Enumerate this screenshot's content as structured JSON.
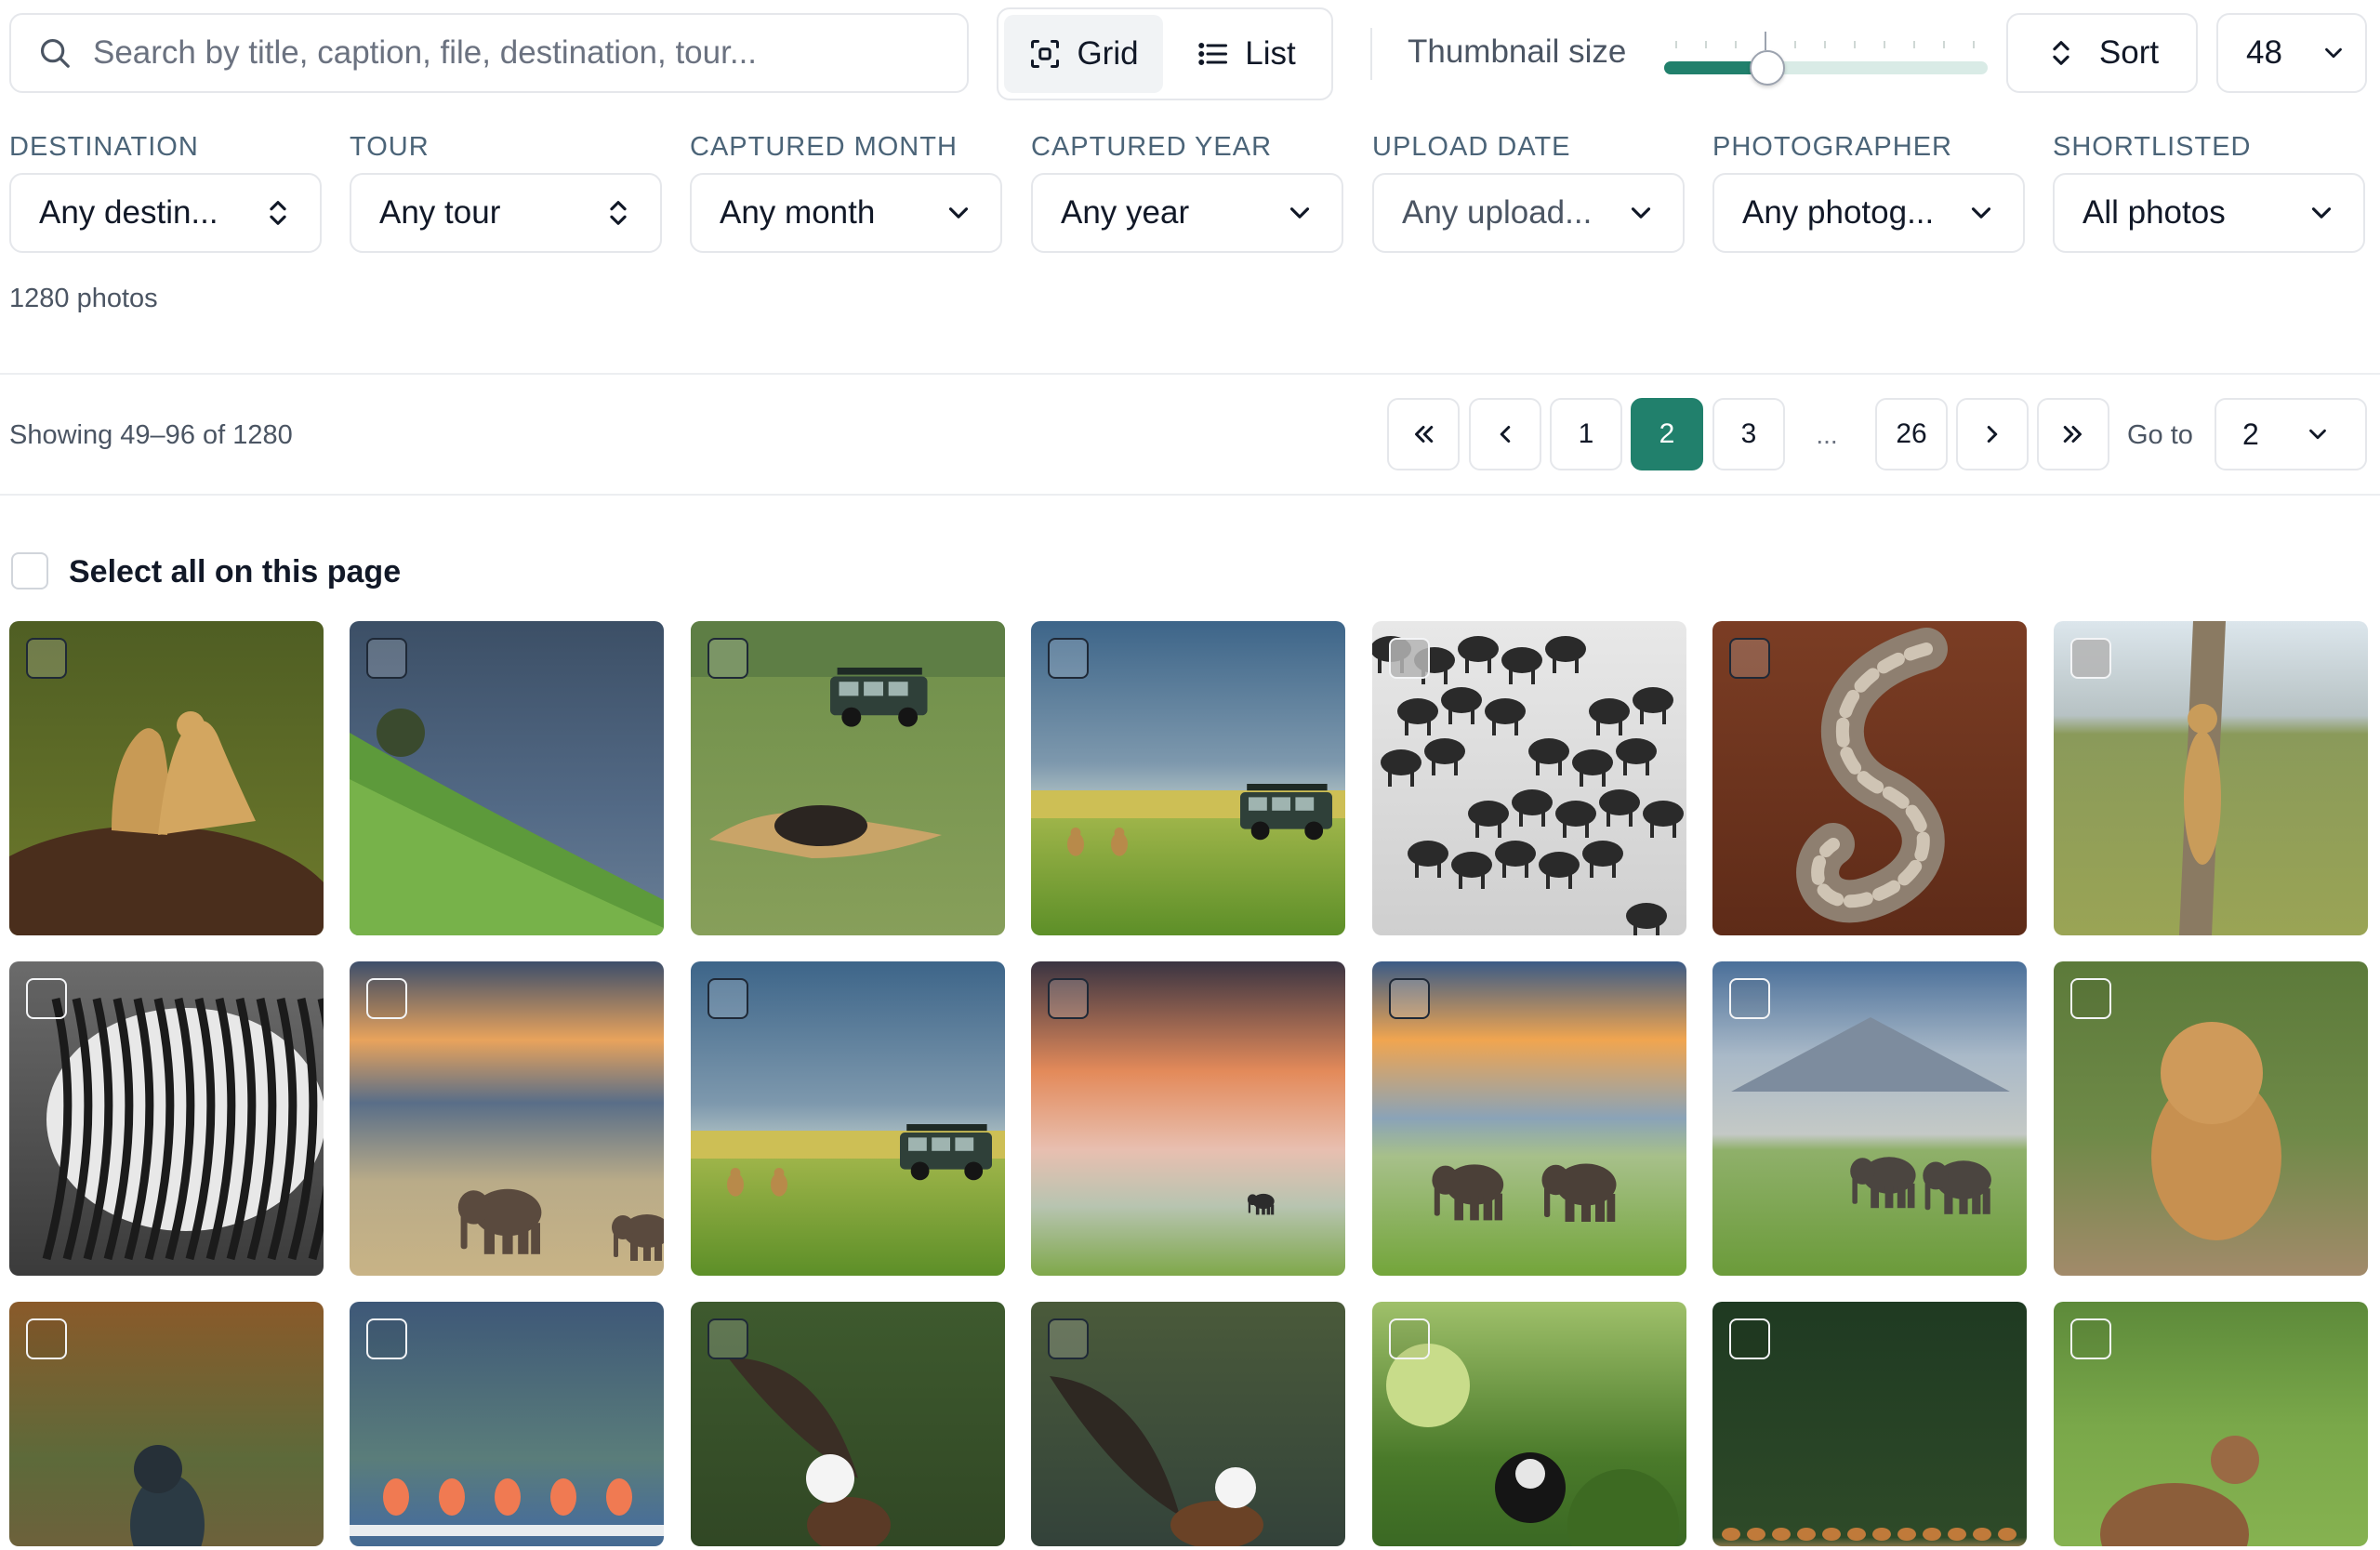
{
  "search": {
    "placeholder": "Search by title, caption, file, destination, tour..."
  },
  "view_toggle": {
    "grid_label": "Grid",
    "list_label": "List",
    "active": "grid"
  },
  "thumbnail": {
    "label": "Thumbnail size",
    "level_percent": 32
  },
  "sort": {
    "label": "Sort",
    "icon": "sort-updown-icon"
  },
  "per_page": {
    "value": "48"
  },
  "filters": [
    {
      "key": "destination",
      "label": "DESTINATION",
      "value": "Any destin...",
      "icon": "updown-icon"
    },
    {
      "key": "tour",
      "label": "TOUR",
      "value": "Any tour",
      "icon": "updown-icon"
    },
    {
      "key": "captured-month",
      "label": "CAPTURED MONTH",
      "value": "Any month",
      "icon": "chevron-down-icon"
    },
    {
      "key": "captured-year",
      "label": "CAPTURED YEAR",
      "value": "Any year",
      "icon": "chevron-down-icon"
    },
    {
      "key": "upload-date",
      "label": "UPLOAD DATE",
      "value": "Any upload...",
      "icon": "chevron-down-icon"
    },
    {
      "key": "photographer",
      "label": "PHOTOGRAPHER",
      "value": "Any photog...",
      "icon": "chevron-down-icon"
    },
    {
      "key": "shortlisted",
      "label": "SHORTLISTED",
      "value": "All photos",
      "icon": "chevron-down-icon"
    }
  ],
  "photo_count": "1280 photos",
  "pagination": {
    "showing": "Showing 49–96 of 1280",
    "pages": [
      "1",
      "2",
      "3",
      "26"
    ],
    "ellipsis": "...",
    "current": "2",
    "goto_label": "Go to",
    "goto_value": "2"
  },
  "select_all_label": "Select all on this page",
  "colors": {
    "accent": "#21806c",
    "border": "#e5e7eb",
    "muted_text": "#4b5563"
  },
  "photos": [
    {
      "subject": "cheetahs-on-termite-mound"
    },
    {
      "subject": "stormy-sky-over-green-hill"
    },
    {
      "subject": "safari-vehicle-lions-on-kill"
    },
    {
      "subject": "safari-vehicle-lions-in-grass"
    },
    {
      "subject": "wildebeest-herd-black-and-white"
    },
    {
      "subject": "puff-adder-snake-on-red-soil"
    },
    {
      "subject": "leopard-climbing-tree"
    },
    {
      "subject": "zebras-black-and-white"
    },
    {
      "subject": "elephant-under-sunset-sky"
    },
    {
      "subject": "safari-vehicle-lions-in-grass"
    },
    {
      "subject": "lone-elephant-under-storm-light"
    },
    {
      "subject": "two-elephants-golden-sky"
    },
    {
      "subject": "elephants-before-kilimanjaro"
    },
    {
      "subject": "lion-cub-walking"
    },
    {
      "subject": "kingfisher-on-branch"
    },
    {
      "subject": "flamingos-on-lake"
    },
    {
      "subject": "fish-eagle-in-flight"
    },
    {
      "subject": "fish-eagle-over-water"
    },
    {
      "subject": "colobus-monkey-in-foliage"
    },
    {
      "subject": "impala-herd-on-plain"
    },
    {
      "subject": "waterbuck-on-grass"
    }
  ]
}
